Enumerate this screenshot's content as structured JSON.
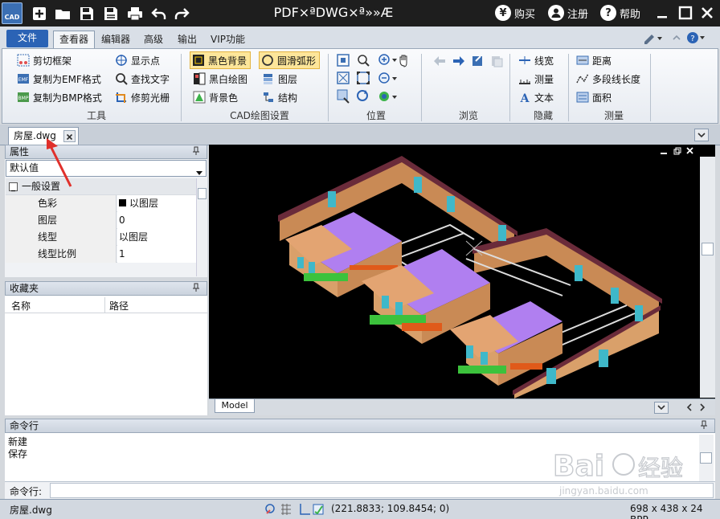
{
  "window": {
    "app_icon_text": "CAD",
    "title": "PDF×ªDWG×ª»»Æ",
    "buy_label": "购买",
    "register_label": "注册",
    "help_label": "帮助",
    "buy_icon_glyph": "¥",
    "help_icon_glyph": "?"
  },
  "ribbon_tabs": {
    "file": "文件",
    "tabs": [
      "查看器",
      "编辑器",
      "高级",
      "输出",
      "VIP功能"
    ],
    "active_index": 0
  },
  "ribbon": {
    "tools": {
      "label": "工具",
      "items": [
        "剪切框架",
        "复制为EMF格式",
        "复制为BMP格式",
        "显示点",
        "查找文字",
        "修剪光栅"
      ]
    },
    "cad_settings": {
      "label": "CAD绘图设置",
      "items": [
        "黑色背景",
        "黑白绘图",
        "背景色",
        "圆滑弧形",
        "图层",
        "结构"
      ]
    },
    "position": {
      "label": "位置"
    },
    "browse": {
      "label": "浏览"
    },
    "hide": {
      "label": "隐藏",
      "items": [
        "线宽",
        "测量",
        "文本"
      ]
    },
    "measure": {
      "label": "测量",
      "items": [
        "距离",
        "多段线长度",
        "面积"
      ]
    }
  },
  "document_tab": {
    "name": "房屋.dwg"
  },
  "properties": {
    "header": "属性",
    "selected": "默认值",
    "section": "一般设置",
    "rows": [
      {
        "name": "色彩",
        "value": "以图层"
      },
      {
        "name": "图层",
        "value": "0"
      },
      {
        "name": "线型",
        "value": "以图层"
      },
      {
        "name": "线型比例",
        "value": "1"
      }
    ]
  },
  "favorites": {
    "header": "收藏夹",
    "columns": [
      "名称",
      "路径"
    ]
  },
  "canvas": {
    "model_tab": "Model"
  },
  "command": {
    "header": "命令行",
    "lines": [
      "新建",
      "保存"
    ],
    "prompt": "命令行:"
  },
  "status": {
    "file": "房屋.dwg",
    "coords": "(221.8833; 109.8454; 0)",
    "image_info": "698 x 438 x 24 BPP"
  },
  "colors": {
    "title_bar": "#1e1e1e",
    "file_tab": "#2b63b5",
    "highlight": "#fde69a",
    "roof": "#b07ff0",
    "wall": "#d9a06a",
    "roof_trim": "#6a2b3a",
    "window": "#3fb8c9",
    "hedge": "#3cc23c",
    "annotation_arrow": "#e0302b"
  },
  "watermark": {
    "brand": "Baidu经验",
    "url": "jingyan.baidu.com"
  }
}
